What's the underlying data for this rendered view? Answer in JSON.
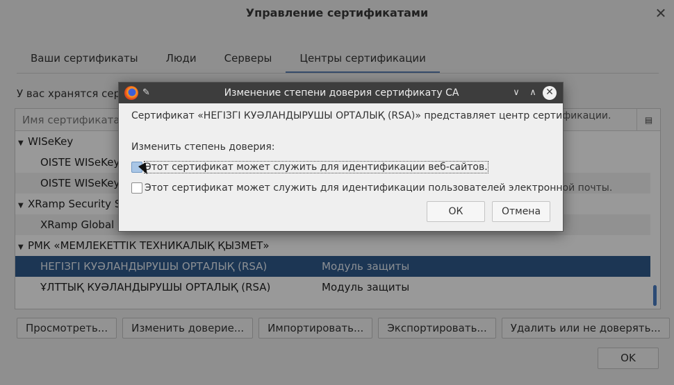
{
  "window": {
    "title": "Управление сертификатами",
    "close_glyph": "✕"
  },
  "tabs": [
    {
      "label": "Ваши сертификаты",
      "active": false
    },
    {
      "label": "Люди",
      "active": false
    },
    {
      "label": "Серверы",
      "active": false
    },
    {
      "label": "Центры сертификации",
      "active": true
    }
  ],
  "info_text": "У вас хранятся серти",
  "tree": {
    "column_header": "Имя сертификата",
    "column_picker_icon": "column-picker-icon",
    "rows": [
      {
        "type": "group",
        "name": "WISeKey",
        "device": ""
      },
      {
        "type": "item",
        "name": "OISTE WISeKey G",
        "device": ""
      },
      {
        "type": "item",
        "name": "OISTE WISeKey G",
        "device": ""
      },
      {
        "type": "group",
        "name": "XRamp Security Ser",
        "device": ""
      },
      {
        "type": "item",
        "name": "XRamp Global C",
        "device": ""
      },
      {
        "type": "group",
        "name": "РМК «МЕМЛЕКЕТТІК ТЕХНИКАЛЫҚ ҚЫЗМЕТ»",
        "device": ""
      },
      {
        "type": "item",
        "name": "НЕГІЗГІ КУӘЛАНДЫРУШЫ ОРТАЛЫҚ (RSA)",
        "device": "Модуль защиты",
        "selected": true
      },
      {
        "type": "item",
        "name": "ҰЛТТЫҚ КУӘЛАНДЫРУШЫ ОРТАЛЫҚ (RSA)",
        "device": "Модуль защиты"
      }
    ]
  },
  "buttons": {
    "view": "Просмотреть...",
    "edit_trust": "Изменить доверие...",
    "import": "Импортировать...",
    "export": "Экспортировать...",
    "delete": "Удалить или не доверять...",
    "ok": "OK"
  },
  "dialog": {
    "title": "Изменение степени доверия сертификату CA",
    "message": "Сертификат «НЕГІЗГІ КУӘЛАНДЫРУШЫ ОРТАЛЫҚ (RSA)» представляет центр сертификации.",
    "label": "Изменить степень доверия:",
    "checkbox_web": "Этот сертификат может служить для идентификации веб-сайтов.",
    "checkbox_email": "Этот сертификат может служить для идентификации пользователей электронной почты.",
    "ok": "ОК",
    "cancel": "Отмена",
    "minimize_glyph": "∨",
    "maximize_glyph": "∧",
    "close_glyph": "✕",
    "pin_glyph": "📌"
  },
  "colors": {
    "selection": "#2f5a8c",
    "tab_accent": "#5b7fb4",
    "dialog_titlebar": "#3d3d3d"
  }
}
